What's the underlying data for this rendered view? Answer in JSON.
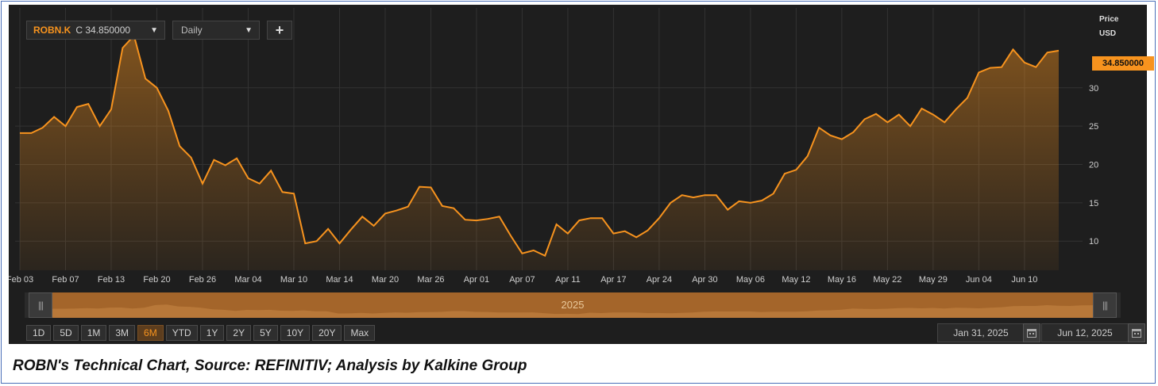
{
  "toolbar": {
    "symbol": "ROBN.K",
    "close_text": "C 34.850000",
    "interval": "Daily",
    "add_label": "+"
  },
  "price_axis": {
    "title": "Price",
    "unit": "USD",
    "last_value": "34.850000"
  },
  "navigator": {
    "year_label": "2025"
  },
  "periods": [
    "1D",
    "5D",
    "1M",
    "3M",
    "6M",
    "YTD",
    "1Y",
    "2Y",
    "5Y",
    "10Y",
    "20Y",
    "Max"
  ],
  "active_period": "6M",
  "date_range": {
    "from": "Jan 31, 2025",
    "to": "Jun 12, 2025"
  },
  "caption": "ROBN's Technical Chart, Source: REFINITIV; Analysis by Kalkine Group",
  "colors": {
    "line": "#f7931e",
    "background": "#1e1e1e",
    "grid": "#333333"
  },
  "chart_data": {
    "type": "area",
    "title": "",
    "xlabel": "",
    "ylabel": "Price",
    "ylim": [
      6.2,
      39.8
    ],
    "yticks": [
      10,
      15,
      20,
      25,
      30
    ],
    "grid": true,
    "x_tick_labels": [
      {
        "label": "Feb 03",
        "index": 0
      },
      {
        "label": "Feb 07",
        "index": 4
      },
      {
        "label": "Feb 13",
        "index": 8
      },
      {
        "label": "Feb 20",
        "index": 12
      },
      {
        "label": "Feb 26",
        "index": 16
      },
      {
        "label": "Mar 04",
        "index": 20
      },
      {
        "label": "Mar 10",
        "index": 24
      },
      {
        "label": "Mar 14",
        "index": 28
      },
      {
        "label": "Mar 20",
        "index": 32
      },
      {
        "label": "Mar 26",
        "index": 36
      },
      {
        "label": "Apr 01",
        "index": 40
      },
      {
        "label": "Apr 07",
        "index": 44
      },
      {
        "label": "Apr 11",
        "index": 48
      },
      {
        "label": "Apr 17",
        "index": 52
      },
      {
        "label": "Apr 24",
        "index": 56
      },
      {
        "label": "Apr 30",
        "index": 60
      },
      {
        "label": "May 06",
        "index": 64
      },
      {
        "label": "May 12",
        "index": 68
      },
      {
        "label": "May 16",
        "index": 72
      },
      {
        "label": "May 22",
        "index": 76
      },
      {
        "label": "May 29",
        "index": 80
      },
      {
        "label": "Jun 04",
        "index": 84
      },
      {
        "label": "Jun 10",
        "index": 88
      }
    ],
    "series": [
      {
        "values": [
          24.1,
          24.1,
          24.8,
          26.2,
          25.0,
          27.5,
          27.9,
          25.0,
          27.2,
          35.2,
          36.8,
          31.2,
          30.0,
          27.0,
          22.4,
          20.9,
          17.5,
          20.6,
          19.9,
          20.8,
          18.2,
          17.5,
          19.2,
          16.4,
          16.2,
          9.7,
          10.0,
          11.6,
          9.7,
          11.5,
          13.2,
          12.0,
          13.6,
          14.0,
          14.5,
          17.1,
          17.0,
          14.6,
          14.3,
          12.8,
          12.7,
          12.9,
          13.2,
          10.7,
          8.4,
          8.8,
          8.1,
          12.2,
          11.0,
          12.7,
          13.0,
          13.0,
          11.0,
          11.3,
          10.5,
          11.4,
          13.0,
          15.0,
          16.0,
          15.7,
          16.0,
          16.0,
          14.1,
          15.2,
          15.0,
          15.3,
          16.2,
          18.8,
          19.3,
          21.1,
          24.8,
          23.8,
          23.3,
          24.2,
          25.9,
          26.6,
          25.5,
          26.5,
          25.0,
          27.3,
          26.5,
          25.5,
          27.2,
          28.7,
          32.0,
          32.6,
          32.7,
          35.0,
          33.3,
          32.7,
          34.6,
          34.85
        ]
      }
    ]
  }
}
